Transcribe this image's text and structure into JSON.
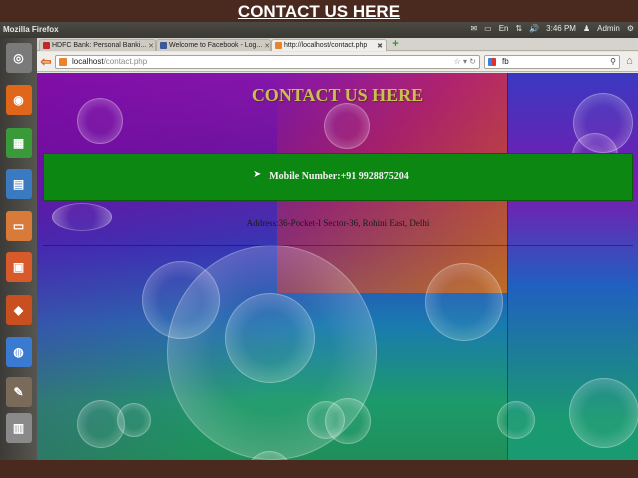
{
  "slide": {
    "title": "CONTACT US HERE"
  },
  "system_bar": {
    "window_title": "Mozilla Firefox",
    "time": "3:46 PM",
    "user": "Admin"
  },
  "launcher": {
    "items": [
      {
        "name": "ubuntu-home-icon",
        "color": "#7a7a7a",
        "glyph": "◎"
      },
      {
        "name": "firefox-icon",
        "color": "#e0661c",
        "glyph": "◉"
      },
      {
        "name": "calc-icon",
        "color": "#3a9a3a",
        "glyph": "▦"
      },
      {
        "name": "impress-icon",
        "color": "#3a7ac0",
        "glyph": "▤"
      },
      {
        "name": "files-icon",
        "color": "#d87a3a",
        "glyph": "▭"
      },
      {
        "name": "presentation-icon",
        "color": "#d85a2a",
        "glyph": "▣"
      },
      {
        "name": "software-center-icon",
        "color": "#c85020",
        "glyph": "◆"
      },
      {
        "name": "chromium-icon",
        "color": "#3a7ad0",
        "glyph": "◍"
      },
      {
        "name": "gimp-icon",
        "color": "#7a6a5a",
        "glyph": "✎"
      },
      {
        "name": "workspace-icon",
        "color": "#8a8a8a",
        "glyph": "▥"
      }
    ]
  },
  "browser": {
    "tabs": [
      {
        "label": "HDFC Bank: Personal Banki...",
        "favicon_color": "#c0282a",
        "close": "✕"
      },
      {
        "label": "Welcome to Facebook - Log...",
        "favicon_color": "#3b5998",
        "close": "✕"
      },
      {
        "label": "http://localhost/contact.php",
        "favicon_color": "#e8852a",
        "close": "✖"
      }
    ],
    "new_tab": "+",
    "url": {
      "host": "localhost",
      "path": "/contact.php"
    },
    "search": {
      "value": "fb"
    }
  },
  "page": {
    "heading": "CONTACT US HERE",
    "mobile": "Mobile Number:+91 9928875204",
    "address": "Address:36-Pocket-I Sector-36, Rohini East, Delhi"
  }
}
